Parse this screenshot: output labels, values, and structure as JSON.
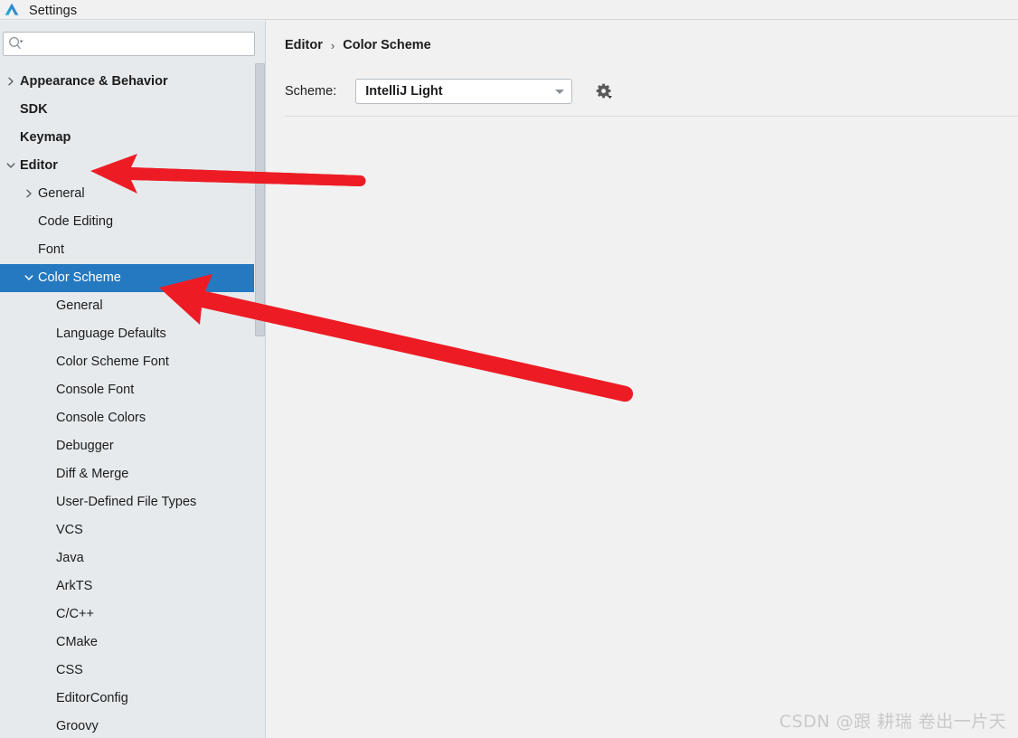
{
  "window": {
    "title": "Settings",
    "logo_icon": "deveco-studio-logo-icon"
  },
  "colors": {
    "sidebar_bg": "#e6eaed",
    "panel_bg": "#f1f1f1",
    "selection_blue": "#2579c0",
    "annotation_red": "#ed1c24",
    "text": "#1d1d1d"
  },
  "sidebar": {
    "search": {
      "value": "",
      "placeholder": "",
      "icon": "search-icon",
      "dropdown_icon": "chevron-down-icon"
    },
    "items": [
      {
        "label": "Appearance & Behavior",
        "indent": 0,
        "bold": true,
        "chevron": "right",
        "selected": false
      },
      {
        "label": "SDK",
        "indent": 0,
        "bold": true,
        "chevron": "none",
        "selected": false
      },
      {
        "label": "Keymap",
        "indent": 0,
        "bold": true,
        "chevron": "none",
        "selected": false
      },
      {
        "label": "Editor",
        "indent": 0,
        "bold": true,
        "chevron": "down",
        "selected": false
      },
      {
        "label": "General",
        "indent": 1,
        "bold": false,
        "chevron": "right",
        "selected": false
      },
      {
        "label": "Code Editing",
        "indent": 1,
        "bold": false,
        "chevron": "none",
        "selected": false
      },
      {
        "label": "Font",
        "indent": 1,
        "bold": false,
        "chevron": "none",
        "selected": false
      },
      {
        "label": "Color Scheme",
        "indent": 1,
        "bold": false,
        "chevron": "down",
        "selected": true
      },
      {
        "label": "General",
        "indent": 2,
        "bold": false,
        "chevron": "none",
        "selected": false
      },
      {
        "label": "Language Defaults",
        "indent": 2,
        "bold": false,
        "chevron": "none",
        "selected": false
      },
      {
        "label": "Color Scheme Font",
        "indent": 2,
        "bold": false,
        "chevron": "none",
        "selected": false
      },
      {
        "label": "Console Font",
        "indent": 2,
        "bold": false,
        "chevron": "none",
        "selected": false
      },
      {
        "label": "Console Colors",
        "indent": 2,
        "bold": false,
        "chevron": "none",
        "selected": false
      },
      {
        "label": "Debugger",
        "indent": 2,
        "bold": false,
        "chevron": "none",
        "selected": false
      },
      {
        "label": "Diff & Merge",
        "indent": 2,
        "bold": false,
        "chevron": "none",
        "selected": false
      },
      {
        "label": "User-Defined File Types",
        "indent": 2,
        "bold": false,
        "chevron": "none",
        "selected": false
      },
      {
        "label": "VCS",
        "indent": 2,
        "bold": false,
        "chevron": "none",
        "selected": false
      },
      {
        "label": "Java",
        "indent": 2,
        "bold": false,
        "chevron": "none",
        "selected": false
      },
      {
        "label": "ArkTS",
        "indent": 2,
        "bold": false,
        "chevron": "none",
        "selected": false
      },
      {
        "label": "C/C++",
        "indent": 2,
        "bold": false,
        "chevron": "none",
        "selected": false
      },
      {
        "label": "CMake",
        "indent": 2,
        "bold": false,
        "chevron": "none",
        "selected": false
      },
      {
        "label": "CSS",
        "indent": 2,
        "bold": false,
        "chevron": "none",
        "selected": false
      },
      {
        "label": "EditorConfig",
        "indent": 2,
        "bold": false,
        "chevron": "none",
        "selected": false
      },
      {
        "label": "Groovy",
        "indent": 2,
        "bold": false,
        "chevron": "none",
        "selected": false
      }
    ],
    "scrollbar": {
      "visible": true
    }
  },
  "content": {
    "breadcrumb": {
      "parent": "Editor",
      "separator": "›",
      "current": "Color Scheme"
    },
    "scheme": {
      "label": "Scheme:",
      "value": "IntelliJ Light",
      "dropdown_icon": "chevron-down-icon",
      "gear_icon": "gear-icon",
      "gear_dropdown_icon": "chevron-down-icon"
    }
  },
  "watermark": {
    "text": "CSDN @跟 耕瑞 卷出一片天"
  },
  "annotations": [
    {
      "name": "arrow-to-editor-item",
      "color": "#ed1c24"
    },
    {
      "name": "arrow-to-color-scheme-item",
      "color": "#ed1c24"
    }
  ]
}
